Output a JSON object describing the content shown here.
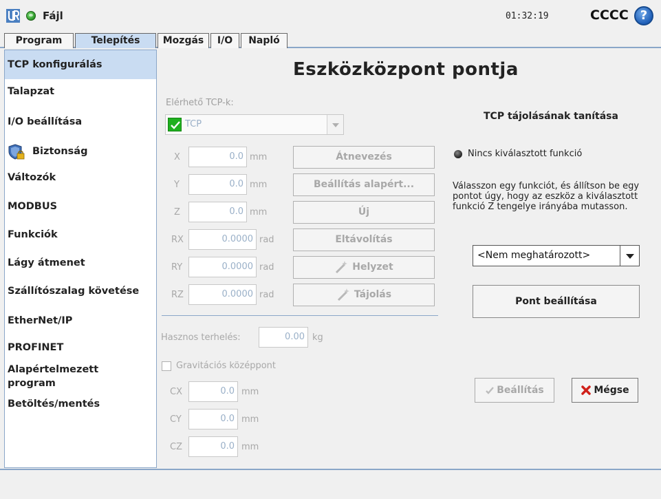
{
  "header": {
    "file_label": "Fájl",
    "clock": "01:32:19",
    "robot_name": "CCCC",
    "help_symbol": "?"
  },
  "tabs": [
    {
      "label": "Program",
      "active": false
    },
    {
      "label": "Telepítés",
      "active": true
    },
    {
      "label": "Mozgás",
      "active": false
    },
    {
      "label": "I/O",
      "active": false
    },
    {
      "label": "Napló",
      "active": false
    }
  ],
  "sidebar": {
    "items": [
      {
        "label": "TCP konfigurálás",
        "active": true
      },
      {
        "label": "Talapzat"
      },
      {
        "label": "I/O beállítása"
      },
      {
        "label": "Biztonság",
        "icon": "shield-lock-icon"
      },
      {
        "label": "Változók"
      },
      {
        "label": "MODBUS"
      },
      {
        "label": "Funkciók"
      },
      {
        "label": "Lágy átmenet"
      },
      {
        "label": "Szállítószalag követése"
      },
      {
        "label": "EtherNet/IP"
      },
      {
        "label": "PROFINET"
      },
      {
        "label": "Alapértelmezett program"
      },
      {
        "label": "Betöltés/mentés"
      }
    ]
  },
  "main": {
    "title": "Eszközközpont pontja",
    "tcp_list_label": "Elérhető TCP-k:",
    "tcp_selected": "TCP",
    "fields": [
      {
        "label": "X",
        "value": "0.0",
        "unit": "mm"
      },
      {
        "label": "Y",
        "value": "0.0",
        "unit": "mm"
      },
      {
        "label": "Z",
        "value": "0.0",
        "unit": "mm"
      },
      {
        "label": "RX",
        "value": "0.0000",
        "unit": "rad"
      },
      {
        "label": "RY",
        "value": "0.0000",
        "unit": "rad"
      },
      {
        "label": "RZ",
        "value": "0.0000",
        "unit": "rad"
      }
    ],
    "buttons": {
      "rename": "Átnevezés",
      "set_default": "Beállítás alapért...",
      "new": "Új",
      "remove": "Eltávolítás",
      "position": "Helyzet",
      "orientation": "Tájolás"
    },
    "payload": {
      "label": "Hasznos terhelés:",
      "value": "0.00",
      "unit": "kg"
    },
    "gravity": {
      "label": "Gravitációs középpont",
      "checked": false,
      "fields": [
        {
          "label": "CX",
          "value": "0.0",
          "unit": "mm"
        },
        {
          "label": "CY",
          "value": "0.0",
          "unit": "mm"
        },
        {
          "label": "CZ",
          "value": "0.0",
          "unit": "mm"
        }
      ]
    }
  },
  "right_panel": {
    "title": "TCP tájolásának tanítása",
    "no_feature": "Nincs kiválasztott funkció",
    "description": "Válasszon egy funkciót, és állítson be egy pontot úgy, hogy az eszköz a kiválasztott funkció Z tengelye irányába mutasson.",
    "feature_select": "<Nem meghatározott>",
    "set_point": "Pont beállítása",
    "apply": "Beállítás",
    "cancel": "Mégse"
  },
  "colors": {
    "accent": "#c9dcf2",
    "border_blue": "#8aa6c8",
    "status_green": "#2f9a2a",
    "cancel_red": "#d0201a"
  }
}
